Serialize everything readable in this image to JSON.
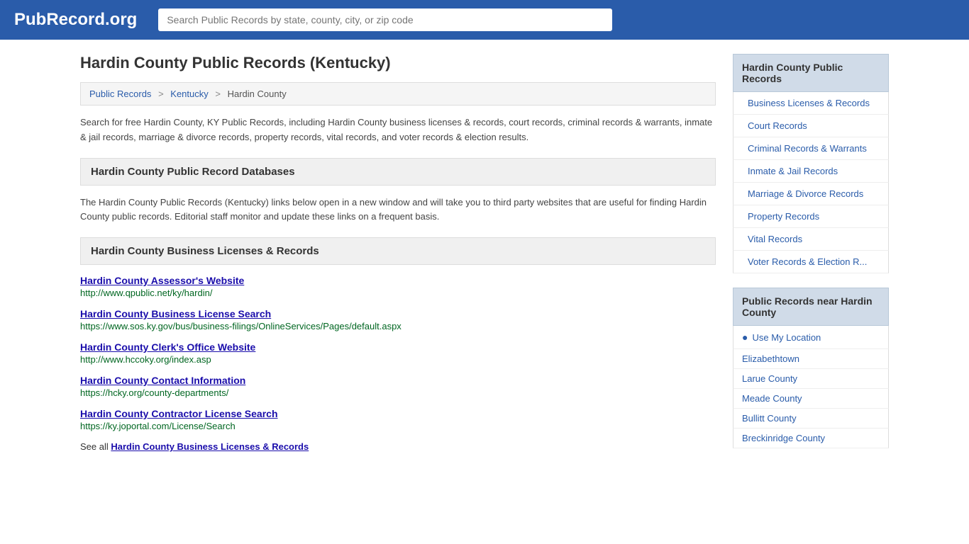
{
  "header": {
    "logo": "PubRecord.org",
    "search_placeholder": "Search Public Records by state, county, city, or zip code"
  },
  "page": {
    "title": "Hardin County Public Records (Kentucky)",
    "breadcrumb": {
      "items": [
        "Public Records",
        "Kentucky",
        "Hardin County"
      ]
    },
    "intro_text": "Search for free Hardin County, KY Public Records, including Hardin County business licenses & records, court records, criminal records & warrants, inmate & jail records, marriage & divorce records, property records, vital records, and voter records & election results.",
    "databases_section_title": "Hardin County Public Record Databases",
    "databases_intro": "The Hardin County Public Records (Kentucky) links below open in a new window and will take you to third party websites that are useful for finding Hardin County public records. Editorial staff monitor and update these links on a frequent basis.",
    "business_section_title": "Hardin County Business Licenses & Records",
    "records": [
      {
        "title": "Hardin County Assessor's Website",
        "url": "http://www.qpublic.net/ky/hardin/"
      },
      {
        "title": "Hardin County Business License Search",
        "url": "https://www.sos.ky.gov/bus/business-filings/OnlineServices/Pages/default.aspx"
      },
      {
        "title": "Hardin County Clerk's Office Website",
        "url": "http://www.hccoky.org/index.asp"
      },
      {
        "title": "Hardin County Contact Information",
        "url": "https://hcky.org/county-departments/"
      },
      {
        "title": "Hardin County Contractor License Search",
        "url": "https://ky.joportal.com/License/Search"
      }
    ],
    "see_all_text": "See all",
    "see_all_link": "Hardin County Business Licenses & Records"
  },
  "sidebar": {
    "public_records_title": "Hardin County Public Records",
    "public_records_items": [
      "Business Licenses & Records",
      "Court Records",
      "Criminal Records & Warrants",
      "Inmate & Jail Records",
      "Marriage & Divorce Records",
      "Property Records",
      "Vital Records",
      "Voter Records & Election R..."
    ],
    "nearby_title": "Public Records near Hardin County",
    "use_location": "Use My Location",
    "nearby_items": [
      "Elizabethtown",
      "Larue County",
      "Meade County",
      "Bullitt County",
      "Breckinridge County"
    ]
  }
}
